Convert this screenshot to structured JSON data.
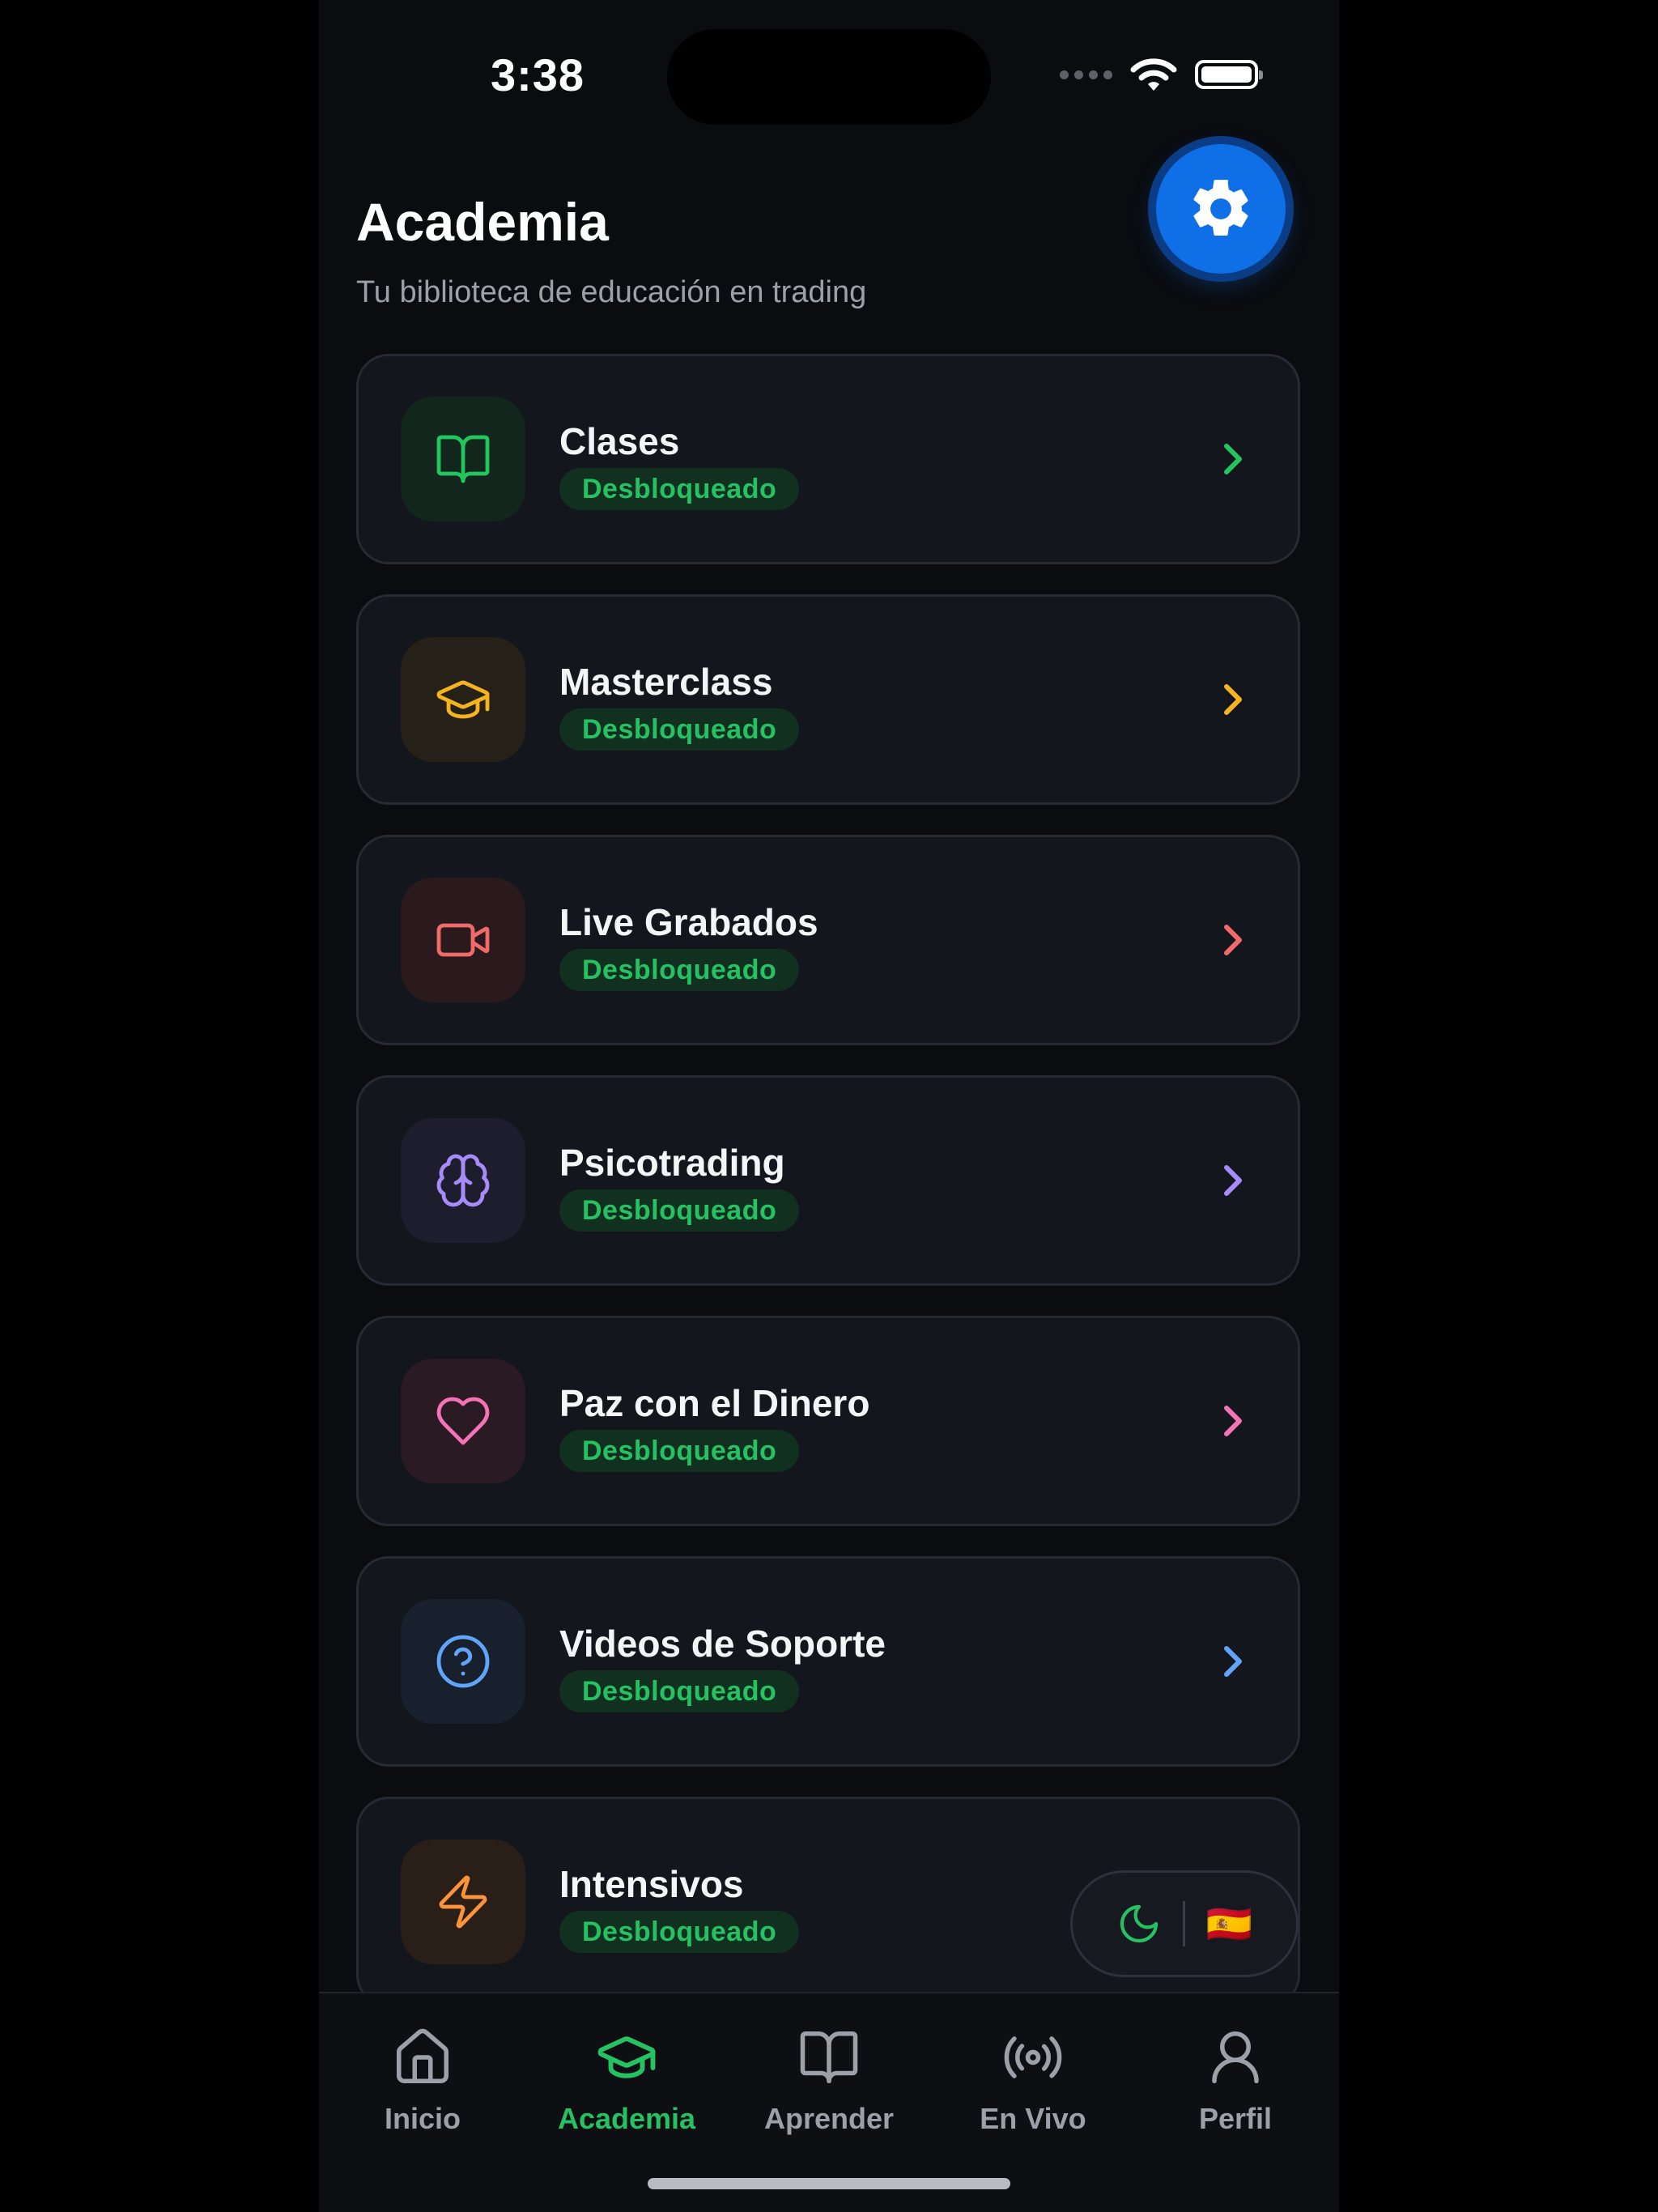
{
  "status_bar": {
    "time": "3:38"
  },
  "header": {
    "title": "Academia",
    "subtitle": "Tu biblioteca de educación en trading",
    "settings_icon": "gear-icon",
    "accent": "#0f6fe6"
  },
  "cards": [
    {
      "title": "Clases",
      "badge": "Desbloqueado",
      "icon": "book-open-icon",
      "color": "#22c55e"
    },
    {
      "title": "Masterclass",
      "badge": "Desbloqueado",
      "icon": "graduation-cap-icon",
      "color": "#f5b41e"
    },
    {
      "title": "Live Grabados",
      "badge": "Desbloqueado",
      "icon": "video-icon",
      "color": "#f06a6a"
    },
    {
      "title": "Psicotrading",
      "badge": "Desbloqueado",
      "icon": "brain-icon",
      "color": "#a78bfa"
    },
    {
      "title": "Paz con el Dinero",
      "badge": "Desbloqueado",
      "icon": "heart-icon",
      "color": "#f472b6"
    },
    {
      "title": "Videos de Soporte",
      "badge": "Desbloqueado",
      "icon": "help-circle-icon",
      "color": "#60a5fa"
    },
    {
      "title": "Intensivos",
      "badge": "Desbloqueado",
      "icon": "lightning-icon",
      "color": "#fb923c"
    }
  ],
  "floating_controls": {
    "theme_icon": "moon-icon",
    "language_flag": "🇪🇸"
  },
  "tabs": [
    {
      "label": "Inicio",
      "icon": "home-icon",
      "active": false
    },
    {
      "label": "Academia",
      "icon": "graduation-cap-icon",
      "active": true
    },
    {
      "label": "Aprender",
      "icon": "book-open-icon",
      "active": false
    },
    {
      "label": "En Vivo",
      "icon": "broadcast-icon",
      "active": false
    },
    {
      "label": "Perfil",
      "icon": "user-icon",
      "active": false
    }
  ],
  "colors": {
    "background": "#0a0c10",
    "card": "#13161c",
    "badge_text": "#25c163",
    "tab_active": "#25c163",
    "tab_inactive": "#9ca0a8"
  }
}
